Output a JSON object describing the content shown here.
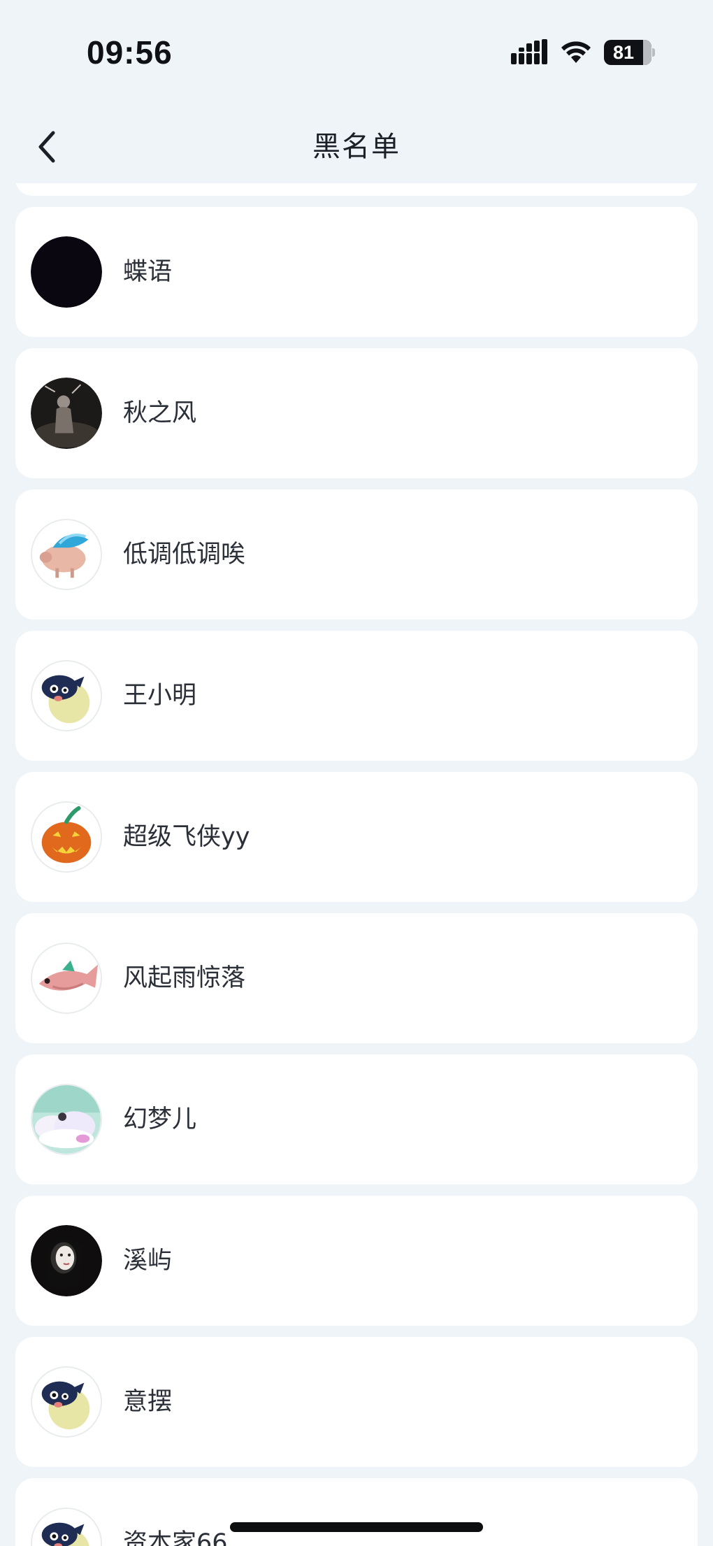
{
  "status_bar": {
    "time": "09:56",
    "battery": "81",
    "signal_icon": "cellular-signal-icon",
    "wifi_icon": "wifi-icon",
    "battery_icon": "battery-icon"
  },
  "header": {
    "title": "黑名单",
    "back_icon": "chevron-left-icon"
  },
  "blacklist": [
    {
      "name": "蝶语",
      "avatar": "black-circle-avatar"
    },
    {
      "name": "秋之风",
      "avatar": "dark-photo-avatar"
    },
    {
      "name": "低调低调唉",
      "avatar": "pig-avatar"
    },
    {
      "name": "王小明",
      "avatar": "pufferfish-avatar"
    },
    {
      "name": "超级飞侠yy",
      "avatar": "pumpkin-avatar"
    },
    {
      "name": "风起雨惊落",
      "avatar": "fish-avatar"
    },
    {
      "name": "幻梦儿",
      "avatar": "cloud-avatar"
    },
    {
      "name": "溪屿",
      "avatar": "portrait-avatar"
    },
    {
      "name": "意摆",
      "avatar": "pufferfish-avatar"
    },
    {
      "name": "资本家66",
      "avatar": "pufferfish-avatar"
    }
  ],
  "colors": {
    "background": "#eef4f7",
    "card": "#ffffff",
    "text": "#2b2f38"
  }
}
